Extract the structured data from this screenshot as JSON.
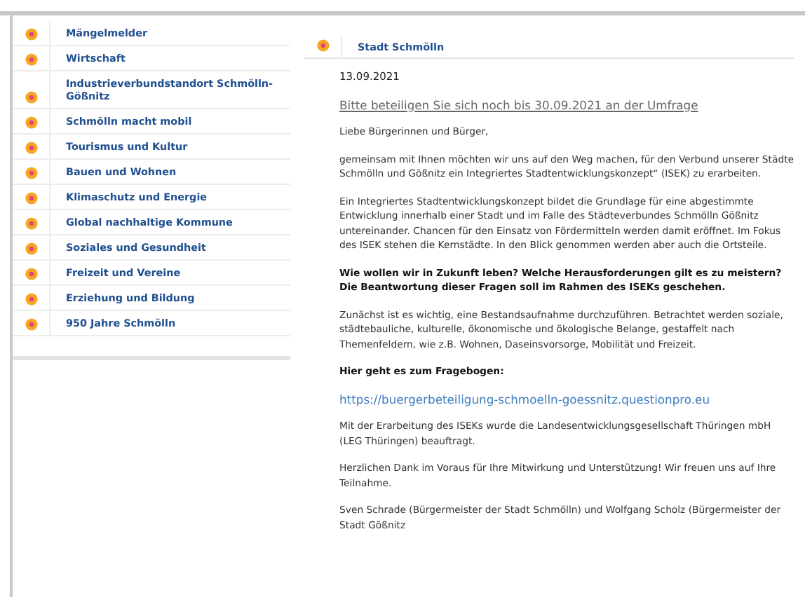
{
  "sidebar": {
    "items": [
      {
        "label": "Mängelmelder"
      },
      {
        "label": "Wirtschaft"
      },
      {
        "label": "Industrieverbundstandort Schmölln-Gößnitz"
      },
      {
        "label": "Schmölln macht mobil"
      },
      {
        "label": "Tourismus und Kultur"
      },
      {
        "label": "Bauen und Wohnen"
      },
      {
        "label": "Klimaschutz und Energie"
      },
      {
        "label": "Global nachhaltige Kommune"
      },
      {
        "label": "Soziales und Gesundheit"
      },
      {
        "label": "Freizeit und Vereine"
      },
      {
        "label": "Erziehung und Bildung"
      },
      {
        "label": "950 Jahre Schmölln"
      }
    ]
  },
  "main": {
    "heading": "Stadt Schmölln",
    "paragraphs": [
      {
        "kind": "date",
        "text": "13.09.2021"
      },
      {
        "kind": "link",
        "text": "Bitte beteiligen Sie sich noch bis 30.09.2021 an der Umfrage"
      },
      {
        "kind": "text",
        "text": "Liebe Bürgerinnen und Bürger,"
      },
      {
        "kind": "text",
        "text": "gemeinsam mit Ihnen möchten wir uns auf den Weg machen, für den Verbund unserer Städte Schmölln und Gößnitz ein Integriertes Stadtentwicklungskonzept“ (ISEK) zu erarbeiten."
      },
      {
        "kind": "text",
        "text": "Ein Integriertes Stadtentwicklungskonzept bildet die Grundlage für eine abgestimmte Entwicklung innerhalb einer Stadt und im Falle des Städteverbundes Schmölln Gößnitz untereinander. Chancen für den Einsatz von Fördermitteln werden damit eröffnet. Im Fokus des ISEK stehen die Kernstädte. In den Blick genommen werden aber auch die Ortsteile."
      },
      {
        "kind": "bold",
        "text": "Wie wollen wir in Zukunft leben? Welche Herausforderungen gilt es zu meistern? Die Beantwortung dieser Fragen soll im Rahmen des ISEKs geschehen."
      },
      {
        "kind": "text",
        "text": "Zunächst ist es wichtig, eine Bestandsaufnahme durchzuführen. Betrachtet werden soziale, städtebauliche, kulturelle, ökonomische und ökologische Belange, gestaffelt nach Themenfeldern, wie z.B. Wohnen, Daseinsvorsorge, Mobilität und Freizeit."
      },
      {
        "kind": "bold",
        "text": "Hier geht es zum Fragebogen:"
      },
      {
        "kind": "url",
        "text": "https://buergerbeteiligung-schmoelln-goessnitz.questionpro.eu"
      },
      {
        "kind": "text",
        "text": "Mit der Erarbeitung des ISEKs wurde die Landesentwicklungsgesellschaft Thüringen mbH (LEG Thüringen) beauftragt."
      },
      {
        "kind": "text",
        "text": "Herzlichen Dank im Voraus für Ihre Mitwirkung und Unterstützung! Wir freuen uns auf Ihre Teilnahme."
      },
      {
        "kind": "text",
        "text": "Sven Schrade (Bürgermeister der Stadt Schmölln) und Wolfgang Scholz (Bürgermeister der Stadt Gößnitz"
      }
    ]
  }
}
